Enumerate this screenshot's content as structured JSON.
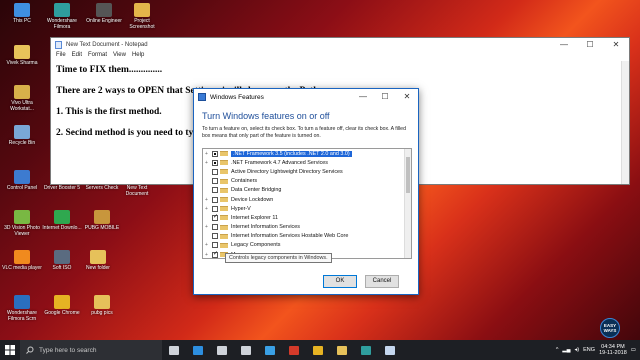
{
  "desktop": {
    "icons": [
      {
        "label": "This PC",
        "color": "#3f8fe0"
      },
      {
        "label": "Wondershare Filmora",
        "color": "#2f9e9e"
      },
      {
        "label": "Online Engineer",
        "color": "#555555"
      },
      {
        "label": "Project Screenshot",
        "color": "#e3b54a"
      },
      {
        "label": "Vivek Sharma",
        "color": "#e8c35a"
      },
      {
        "label": "Vivo Ultra Workstat...",
        "color": "#d8b04a"
      },
      {
        "label": "Recycle Bin",
        "color": "#7aa7d6"
      },
      {
        "label": "Control Panel",
        "color": "#3d7bd0"
      },
      {
        "label": "Driver Booster 5",
        "color": "#d64530"
      },
      {
        "label": "Servers Check",
        "color": "#4a90c8"
      },
      {
        "label": "New Text Document",
        "color": "#f2f2f2"
      },
      {
        "label": "3D Vision Photo Viewer",
        "color": "#79b843"
      },
      {
        "label": "Internet Downlo...",
        "color": "#2fa84f"
      },
      {
        "label": "PUBG MOBILE",
        "color": "#c8963c"
      },
      {
        "label": "VLC media player",
        "color": "#f08a1e"
      },
      {
        "label": "Soft ISO",
        "color": "#5a6b80"
      },
      {
        "label": "New folder",
        "color": "#e6c15a"
      },
      {
        "label": "Wondershare Filmora Scrn",
        "color": "#2a6fc0"
      },
      {
        "label": "Google Chrome",
        "color": "#e6b323"
      },
      {
        "label": "pubg pics",
        "color": "#e6c15a"
      }
    ]
  },
  "notepad": {
    "title": "New Text Document - Notepad",
    "menu": [
      "File",
      "Edit",
      "Format",
      "View",
      "Help"
    ],
    "lines": [
      "Time to FIX them..............",
      "There are 2 ways to OPEN that Settings, i will show you the Path",
      "1. This is the first method.",
      "2. Secind method is you need to type ( optionalfeatures ) i will show you."
    ],
    "controls": {
      "minimize": "—",
      "maximize": "☐",
      "close": "✕"
    }
  },
  "features_dialog": {
    "title": "Windows Features",
    "heading": "Turn Windows features on or off",
    "description": "To turn a feature on, select its check box. To turn a feature off, clear its check box. A filled box means that only part of the feature is turned on.",
    "features": [
      {
        "label": ".NET Framework 3.5 (includes .NET 2.0 and 3.0)",
        "state": "partial",
        "expand": "+",
        "selected": true
      },
      {
        "label": ".NET Framework 4.7 Advanced Services",
        "state": "partial",
        "expand": "+",
        "selected": false
      },
      {
        "label": "Active Directory Lightweight Directory Services",
        "state": "off",
        "expand": "",
        "selected": false
      },
      {
        "label": "Containers",
        "state": "off",
        "expand": "",
        "selected": false
      },
      {
        "label": "Data Center Bridging",
        "state": "off",
        "expand": "",
        "selected": false
      },
      {
        "label": "Device Lockdown",
        "state": "off",
        "expand": "+",
        "selected": false
      },
      {
        "label": "Hyper-V",
        "state": "off",
        "expand": "+",
        "selected": false
      },
      {
        "label": "Internet Explorer 11",
        "state": "checked",
        "expand": "",
        "selected": false
      },
      {
        "label": "Internet Information Services",
        "state": "off",
        "expand": "+",
        "selected": false
      },
      {
        "label": "Internet Information Services Hostable Web Core",
        "state": "off",
        "expand": "",
        "selected": false
      },
      {
        "label": "Legacy Components",
        "state": "off",
        "expand": "+",
        "selected": false
      },
      {
        "label": "Me",
        "state": "checked",
        "expand": "+",
        "selected": false
      },
      {
        "label": "Microsoft Message Queue (MSMQ) Server",
        "state": "off",
        "expand": "+",
        "selected": false
      }
    ],
    "tooltip": "Controls legacy components in Windows.",
    "ok_label": "OK",
    "cancel_label": "Cancel"
  },
  "taskbar": {
    "search_placeholder": "Type here to search",
    "apps": [
      {
        "name": "task-view",
        "color": "#cfd3da"
      },
      {
        "name": "edge",
        "color": "#2d8fe0"
      },
      {
        "name": "store",
        "color": "#cfd3da"
      },
      {
        "name": "mail",
        "color": "#cfd3da"
      },
      {
        "name": "app-blue",
        "color": "#3aa0e6"
      },
      {
        "name": "app-red",
        "color": "#d43a2a"
      },
      {
        "name": "chrome",
        "color": "#e6b323"
      },
      {
        "name": "file-explorer",
        "color": "#e6c15a"
      },
      {
        "name": "filmora",
        "color": "#2f9e9e"
      },
      {
        "name": "notepad",
        "color": "#c4d6ee"
      }
    ],
    "language": "ENG",
    "time": "04:34 PM",
    "date": "19-11-2018"
  },
  "watermark": {
    "line1": "EASY",
    "line2": "WAYS"
  }
}
